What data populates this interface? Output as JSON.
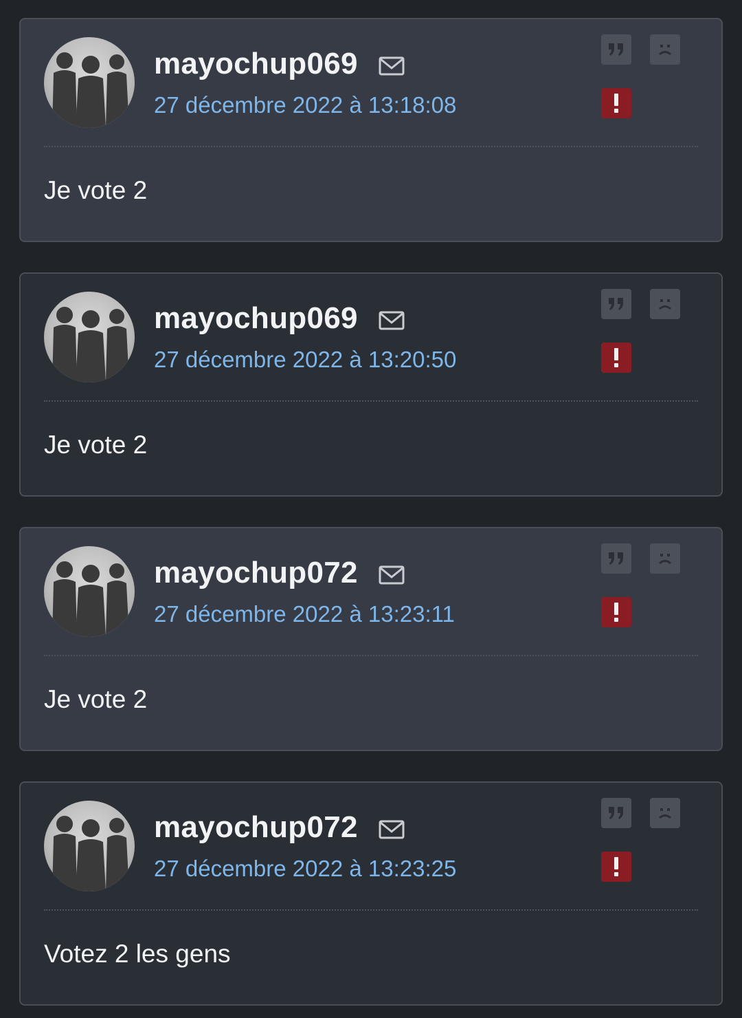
{
  "posts": [
    {
      "username": "mayochup069",
      "date": "27 décembre 2022 à 13:18:08",
      "message": "Je vote 2"
    },
    {
      "username": "mayochup069",
      "date": "27 décembre 2022 à 13:20:50",
      "message": "Je vote 2"
    },
    {
      "username": "mayochup072",
      "date": "27 décembre 2022 à 13:23:11",
      "message": "Je vote 2"
    },
    {
      "username": "mayochup072",
      "date": "27 décembre 2022 à 13:23:25",
      "message": "Votez 2 les gens"
    }
  ],
  "icons": {
    "private_message": "mail-icon",
    "quote": "quote-icon",
    "sad": "sad-face-icon",
    "report": "exclamation-icon"
  },
  "colors": {
    "background": "#202327",
    "card_light": "#363b45",
    "card_dark": "#2a2e35",
    "date_link": "#7fb6e9",
    "report_red": "#8a1d24",
    "action_gray": "#4b5059"
  }
}
